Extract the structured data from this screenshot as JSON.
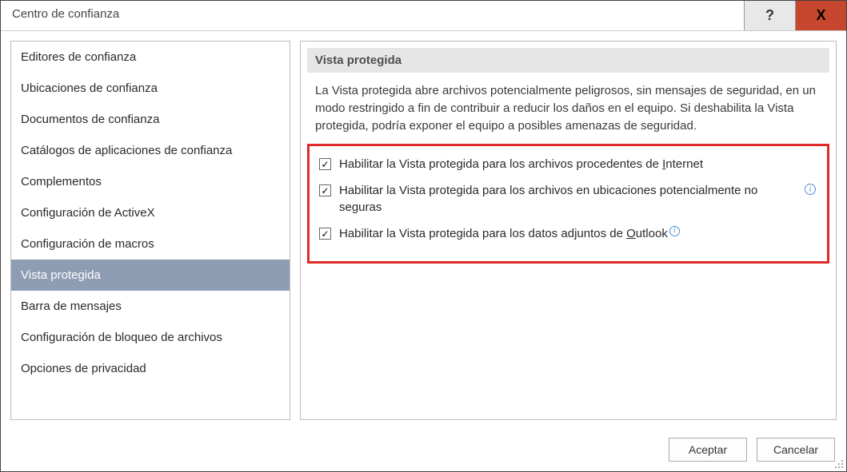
{
  "titlebar": {
    "title": "Centro de confianza",
    "help": "?",
    "close": "X"
  },
  "sidebar": {
    "items": [
      {
        "label": "Editores de confianza"
      },
      {
        "label": "Ubicaciones de confianza"
      },
      {
        "label": "Documentos de confianza"
      },
      {
        "label": "Catálogos de aplicaciones de confianza"
      },
      {
        "label": "Complementos"
      },
      {
        "label": "Configuración de ActiveX"
      },
      {
        "label": "Configuración de macros"
      },
      {
        "label": "Vista protegida",
        "active": true
      },
      {
        "label": "Barra de mensajes"
      },
      {
        "label": "Configuración de bloqueo de archivos"
      },
      {
        "label": "Opciones de privacidad"
      }
    ]
  },
  "section": {
    "header": "Vista protegida",
    "description": "La Vista protegida abre archivos potencialmente peligrosos, sin mensajes de seguridad, en un modo restringido a fin de contribuir a reducir los daños en el equipo. Si deshabilita la Vista protegida, podría exponer el equipo a posibles amenazas de seguridad.",
    "options": [
      {
        "checked": true,
        "pre": "Habilitar la Vista protegida para los archivos procedentes de ",
        "ul": "I",
        "post": "nternet",
        "info": false
      },
      {
        "checked": true,
        "pre": "Habilitar la Vista protegida para los archivos en ubicaciones potencialmente no seguras",
        "ul": "",
        "post": "",
        "info": true
      },
      {
        "checked": true,
        "pre": "Habilitar la Vista protegida para los datos adjuntos de ",
        "ul": "O",
        "post": "utlook",
        "info": "inline"
      }
    ]
  },
  "footer": {
    "ok": "Aceptar",
    "cancel": "Cancelar"
  }
}
